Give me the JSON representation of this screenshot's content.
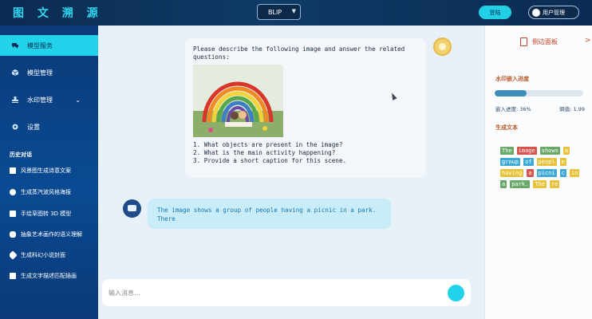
{
  "header": {
    "brand": "图 文 溯 源",
    "model_select": "BLIP",
    "login_label": "登陆",
    "user_label": "用户管理"
  },
  "sidebar": {
    "items": [
      {
        "label": "模型服务",
        "icon": "chat-icon",
        "active": true
      },
      {
        "label": "模型管理",
        "icon": "cube-icon"
      },
      {
        "label": "水印管理",
        "icon": "stamp-icon",
        "has_chevron": true
      },
      {
        "label": "设置",
        "icon": "gear-icon"
      }
    ],
    "history_title": "历史对话",
    "history": [
      {
        "label": "风景图生成诗意文案",
        "icon": "image-icon"
      },
      {
        "label": "生成蒸汽波风格海报",
        "icon": "palette-icon"
      },
      {
        "label": "手绘草图转 3D 模型",
        "icon": "cube-icon"
      },
      {
        "label": "抽象艺术画作的语义理解",
        "icon": "brain-icon"
      },
      {
        "label": "生成科幻小说封面",
        "icon": "rocket-icon"
      },
      {
        "label": "生成文字描述匹配插画",
        "icon": "book-icon"
      }
    ]
  },
  "chat": {
    "user_message": {
      "intro": "Please describe the following image and answer the related questions:",
      "questions": [
        "1. What objects are present in the image?",
        "2. What is the main activity happening?",
        "3. Provide a short caption for this scene."
      ]
    },
    "bot_message": "The image shows a group of people having a picnic in a park. There",
    "input_placeholder": "输入消息..."
  },
  "panel": {
    "title": "侧边面板",
    "close": ">",
    "watermark_label": "水印嵌入进度",
    "progress_percent": 36,
    "progress_text": "嵌入进度: 36%",
    "entropy_text": "熵值: 1.99",
    "generated_label": "生成文本",
    "tokens": [
      {
        "t": "The",
        "c": "#6aa86a"
      },
      {
        "t": "image",
        "c": "#d9534f"
      },
      {
        "t": "shows",
        "c": "#6aa86a"
      },
      {
        "t": "a",
        "c": "#e8c23a"
      },
      {
        "t": "group",
        "c": "#3fa9d6"
      },
      {
        "t": "of",
        "c": "#3fa9d6"
      },
      {
        "t": "peopl",
        "c": "#e8c23a"
      },
      {
        "t": "e",
        "c": "#e8c23a"
      },
      {
        "t": "having",
        "c": "#e8c23a"
      },
      {
        "t": "a",
        "c": "#d9534f"
      },
      {
        "t": "picni",
        "c": "#3fa9d6"
      },
      {
        "t": "c",
        "c": "#3fa9d6"
      },
      {
        "t": "in",
        "c": "#e8c23a"
      },
      {
        "t": "a",
        "c": "#6aa86a"
      },
      {
        "t": "park.",
        "c": "#6aa86a"
      },
      {
        "t": "The",
        "c": "#e8c23a"
      },
      {
        "t": "re",
        "c": "#e8c23a"
      }
    ]
  }
}
